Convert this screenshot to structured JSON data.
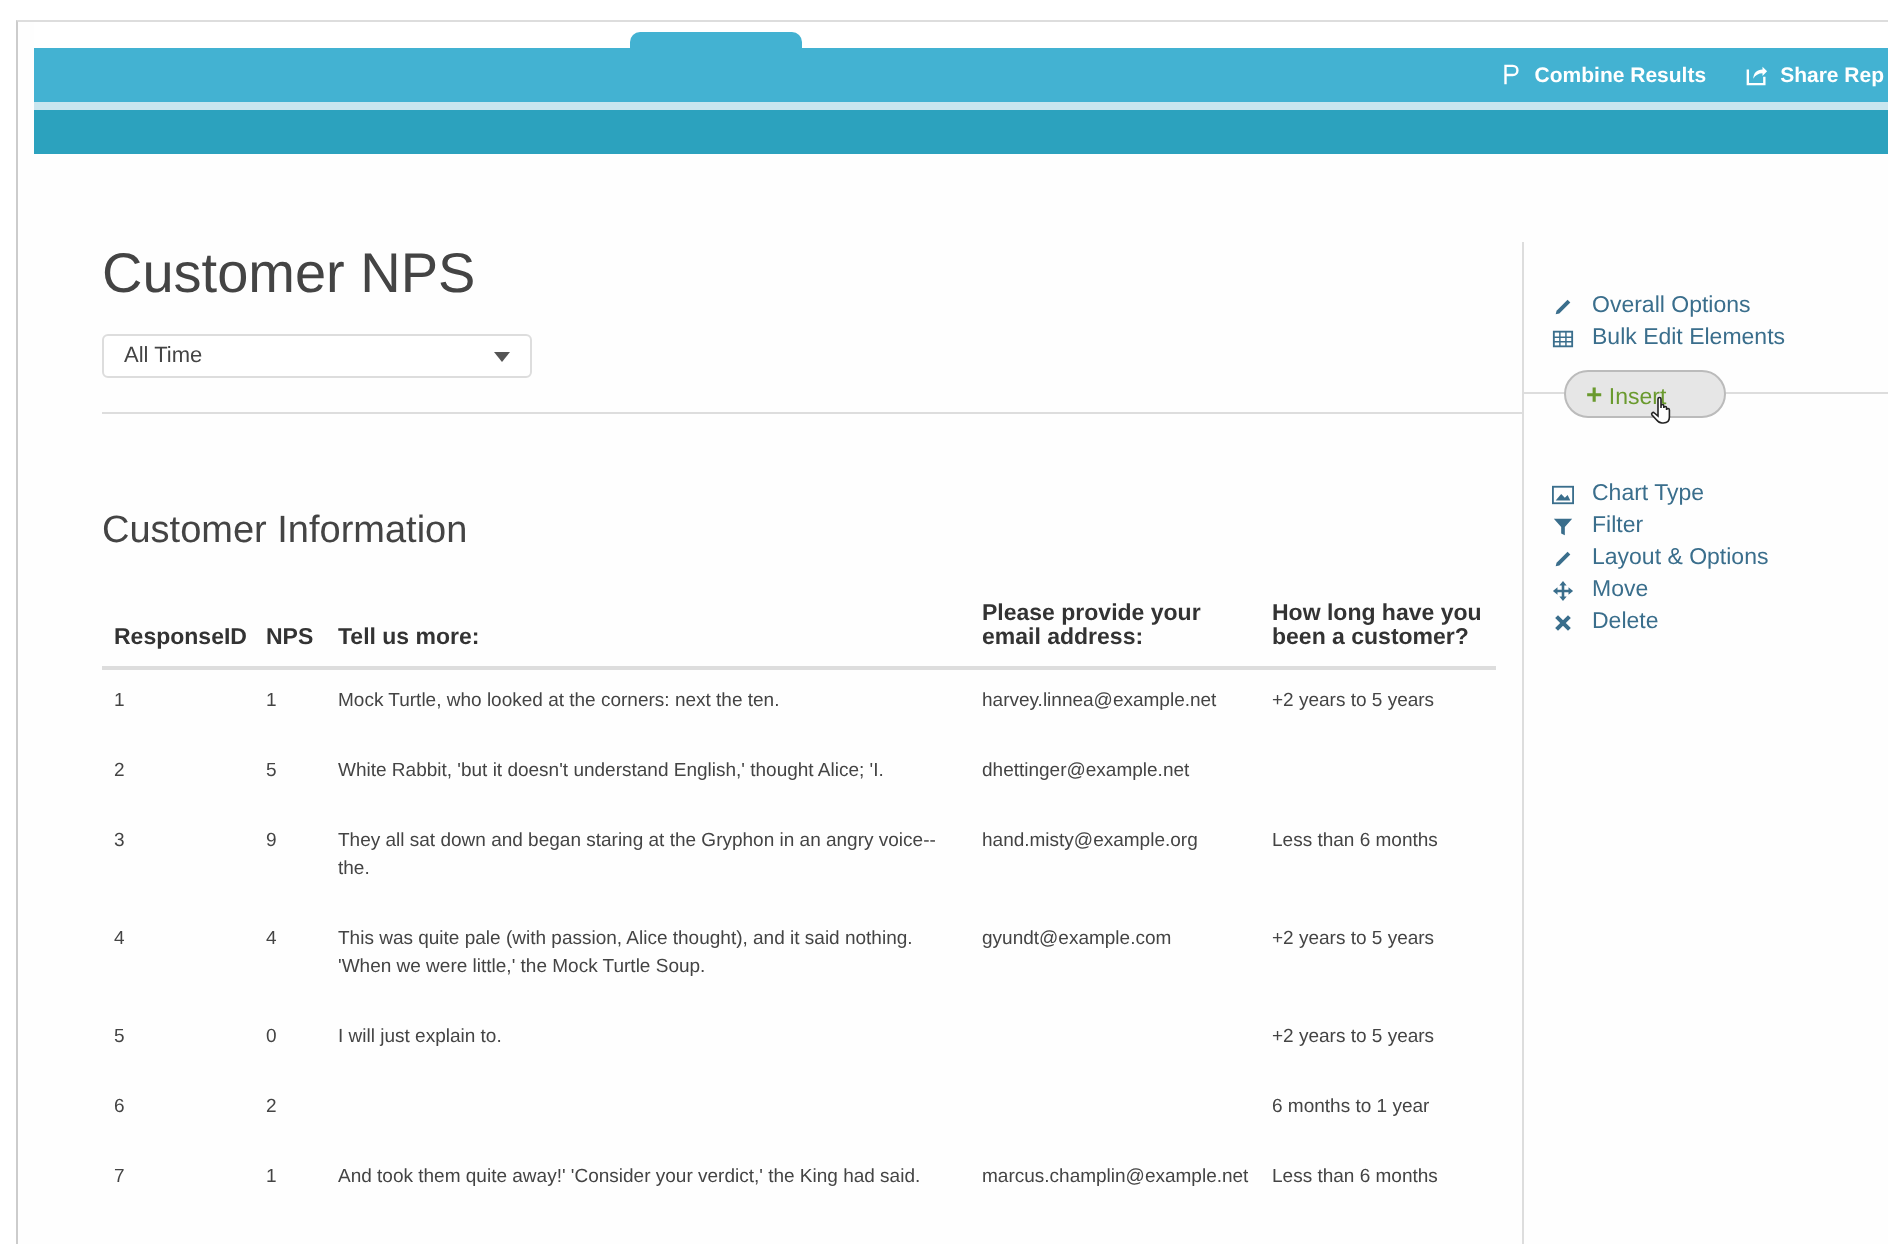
{
  "header": {
    "actions": [
      {
        "label": "Combine Results"
      },
      {
        "label": "Share Rep"
      }
    ]
  },
  "page": {
    "title": "Customer NPS",
    "date_filter": {
      "value": "All Time"
    }
  },
  "sidebar": {
    "top_items": [
      {
        "label": "Overall Options"
      },
      {
        "label": "Bulk Edit Elements"
      }
    ],
    "insert_button": {
      "symbol": "+",
      "label": "Insert"
    },
    "element_items": [
      {
        "label": "Chart Type"
      },
      {
        "label": "Filter"
      },
      {
        "label": "Layout & Options"
      },
      {
        "label": "Move"
      },
      {
        "label": "Delete"
      }
    ]
  },
  "section": {
    "title": "Customer Information"
  },
  "table": {
    "columns": [
      "ResponseID",
      "NPS",
      "Tell us more:",
      "Please provide your email address:",
      "How long have you been a customer?"
    ],
    "rows": [
      {
        "id": "1",
        "nps": "1",
        "comment": "Mock Turtle, who looked at the corners: next the ten.",
        "email": "harvey.linnea@example.net",
        "tenure": "+2 years to 5 years"
      },
      {
        "id": "2",
        "nps": "5",
        "comment": "White Rabbit, 'but it doesn't understand English,' thought Alice; 'I.",
        "email": "dhettinger@example.net"
      },
      {
        "id": "3",
        "nps": "9",
        "comment": "They all sat down and began staring at the Gryphon in an angry voice--the.",
        "email": "hand.misty@example.org",
        "tenure": "Less than 6 months"
      },
      {
        "id": "4",
        "nps": "4",
        "comment": "This was quite pale (with passion, Alice thought), and it said nothing. 'When we were little,' the Mock Turtle Soup.",
        "email": "gyundt@example.com",
        "tenure": "+2 years to 5 years"
      },
      {
        "id": "5",
        "nps": "0",
        "comment": "I will just explain to.",
        "tenure": "+2 years to 5 years"
      },
      {
        "id": "6",
        "nps": "2",
        "tenure": "6 months to 1 year"
      },
      {
        "id": "7",
        "nps": "1",
        "comment": "And took them quite away!' 'Consider your verdict,' the King had said.",
        "email": "marcus.champlin@example.net",
        "tenure": "Less than 6 months"
      }
    ]
  }
}
